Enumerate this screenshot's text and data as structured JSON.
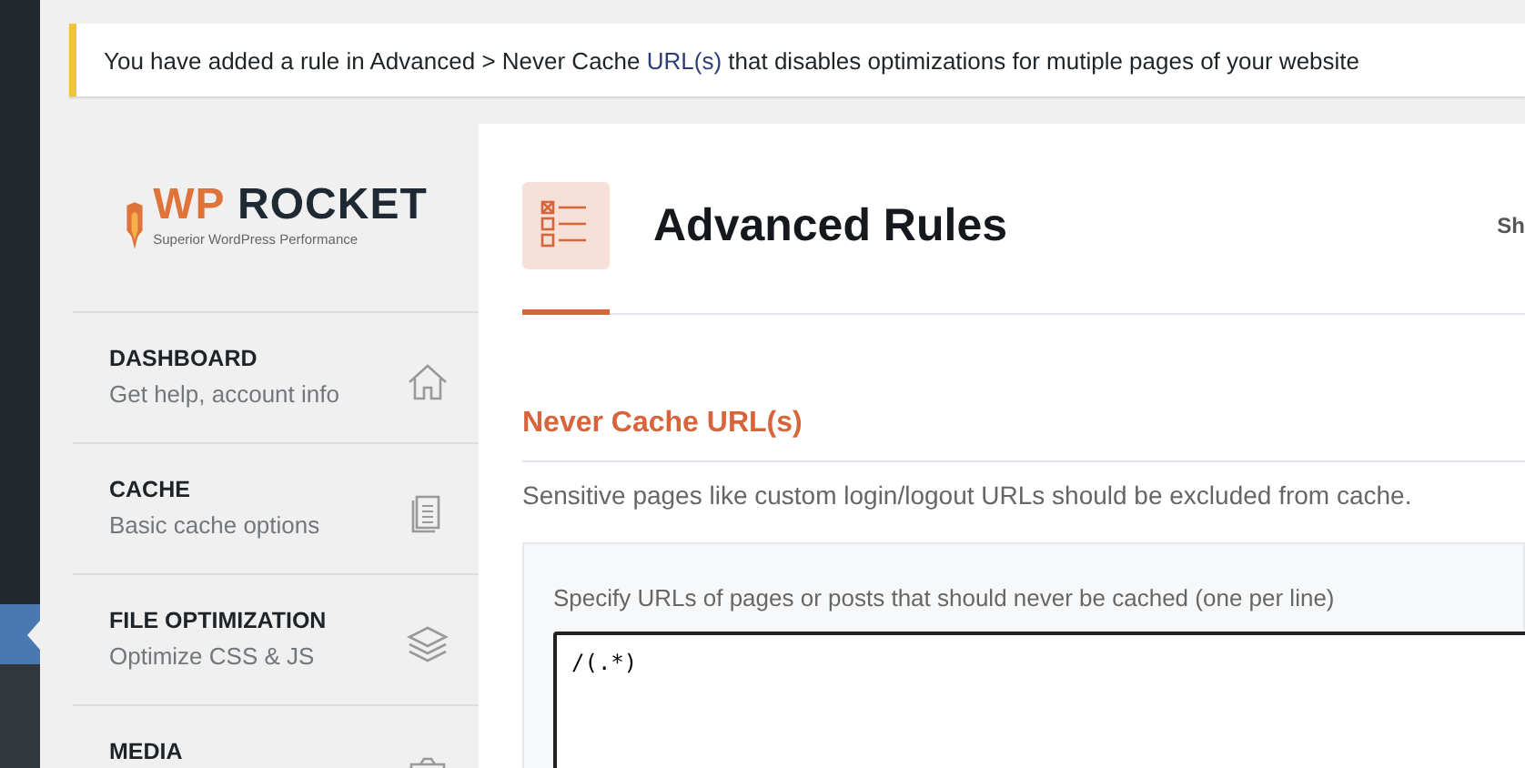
{
  "notice": {
    "text_before": "You have added a rule in Advanced > Never Cache",
    "link": "URL(s)",
    "text_after": "that disables optimizations for mutiple pages of your website"
  },
  "logo": {
    "brand_highlight": "WP",
    "brand": "ROCKET",
    "tagline": "Superior WordPress Performance"
  },
  "sidebar": {
    "items": [
      {
        "title": "DASHBOARD",
        "subtitle": "Get help, account info",
        "kind": "home"
      },
      {
        "title": "CACHE",
        "subtitle": "Basic cache options",
        "kind": "document"
      },
      {
        "title": "FILE OPTIMIZATION",
        "subtitle": "Optimize CSS & JS",
        "kind": "layers"
      },
      {
        "title": "MEDIA",
        "kind": "media"
      }
    ]
  },
  "header": {
    "title": "Advanced Rules",
    "cut_text": "Sh"
  },
  "section": {
    "title": "Never Cache URL(s)",
    "description": "Sensitive pages like custom login/logout URLs should be excluded from cache.",
    "field_label": "Specify URLs of pages or posts that should never be cached (one per line)",
    "value": "/(.*)"
  }
}
